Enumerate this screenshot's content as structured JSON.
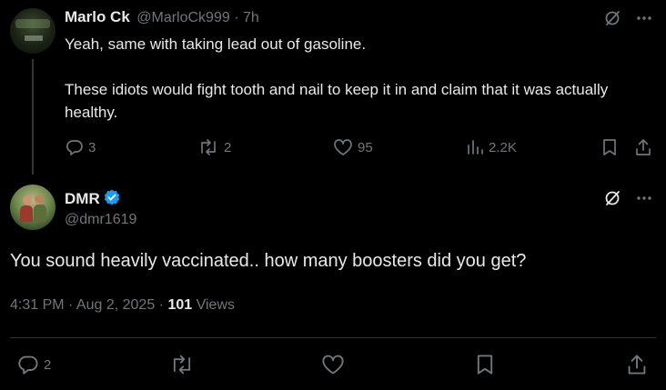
{
  "parent_post": {
    "display_name": "Marlo Ck",
    "handle": "@MarloCk999",
    "separator": "·",
    "time_ago": "7h",
    "text": "Yeah, same with taking lead out of gasoline.\n\nThese idiots would fight tooth and nail to keep it in and claim that it was actually healthy.",
    "replies": "3",
    "reposts": "2",
    "likes": "95",
    "views": "2.2K"
  },
  "main_post": {
    "display_name": "DMR",
    "handle": "@dmr1619",
    "text": "You sound heavily vaccinated.. how many boosters did you get?",
    "timestamp": "4:31 PM · Aug 2, 2025 · ",
    "views_count": "101",
    "views_label": " Views",
    "replies": "2"
  },
  "colors": {
    "background": "#000000",
    "text_primary": "#e7e9ea",
    "text_secondary": "#71767b",
    "verified_blue": "#1d9bf0",
    "divider": "#2f3336"
  },
  "icons": [
    "grok-icon",
    "more-icon",
    "reply-icon",
    "repost-icon",
    "like-icon",
    "views-icon",
    "bookmark-icon",
    "share-icon",
    "verified-badge-icon"
  ]
}
